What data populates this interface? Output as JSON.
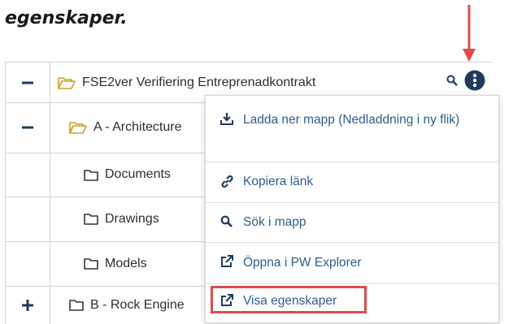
{
  "document": {
    "caption_text": "egenskaper."
  },
  "tree": {
    "rows": [
      {
        "toggle": "collapse",
        "name": "FSE2ver Verifiering Entreprenadkontrakt",
        "icon": "folder-open-icon"
      },
      {
        "toggle": "collapse",
        "name": "A - Architecture",
        "icon": "folder-open-icon"
      },
      {
        "toggle": "none",
        "name": "Documents",
        "icon": "folder-icon"
      },
      {
        "toggle": "none",
        "name": "Drawings",
        "icon": "folder-icon"
      },
      {
        "toggle": "none",
        "name": "Models",
        "icon": "folder-icon"
      },
      {
        "toggle": "expand",
        "name": "B - Rock Engine",
        "icon": "folder-icon"
      }
    ],
    "actions": [
      "search-icon",
      "more-info-icon"
    ]
  },
  "context_menu": {
    "items": [
      {
        "label": "Ladda ner mapp (Nedladdning i ny flik)",
        "icon": "download-icon"
      },
      {
        "label": "Kopiera länk",
        "icon": "link-icon"
      },
      {
        "label": "Sök i mapp",
        "icon": "search-icon"
      },
      {
        "label": "Öppna i PW Explorer",
        "icon": "external-link-icon"
      },
      {
        "label": "Visa egenskaper",
        "icon": "external-link-icon",
        "highlighted": true
      }
    ]
  },
  "colors": {
    "folder_open": "#c9a227",
    "folder": "#333333",
    "menu_text": "#2f5d8c",
    "highlight": "#e24a4a",
    "arrow": "#e24a4a"
  }
}
